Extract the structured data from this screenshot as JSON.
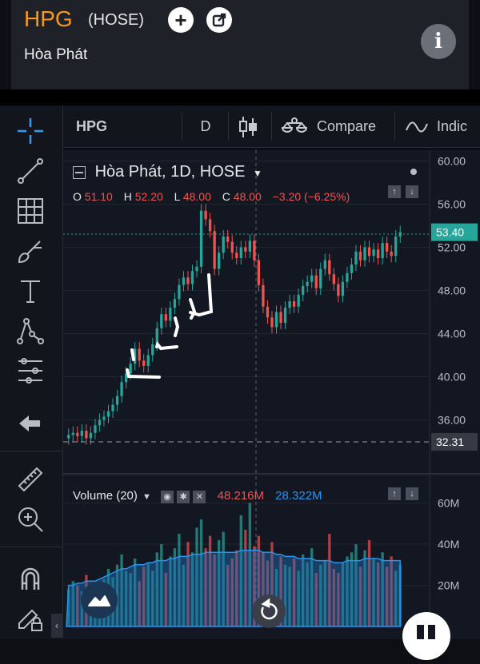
{
  "header": {
    "symbol": "HPG",
    "exchange": "(HOSE)",
    "company_name": "Hòa Phát",
    "add_icon": "plus-circle-icon",
    "share_icon": "external-link-icon",
    "info_icon": "info-icon"
  },
  "toolbar": {
    "symbol": "HPG",
    "interval": "D",
    "chart_type_icon": "candlestick-icon",
    "compare_label": "Compare",
    "indicators_label": "Indic"
  },
  "sidebar": {
    "tools": [
      "crosshair-icon",
      "trendline-icon",
      "fib-grid-icon",
      "brush-icon",
      "text-icon",
      "pattern-icon",
      "prediction-icon",
      "back-arrow-icon",
      "ruler-icon",
      "zoom-in-icon",
      "magnet-icon",
      "lock-draw-icon"
    ]
  },
  "legend": {
    "title": "Hòa Phát, 1D, HOSE",
    "o_label": "O",
    "o_value": "51.10",
    "h_label": "H",
    "h_value": "52.20",
    "l_label": "L",
    "l_value": "48.00",
    "c_label": "C",
    "c_value": "48.00",
    "change": "−3.20 (−6.25%)"
  },
  "volume_legend": {
    "label": "Volume (20)",
    "value1": "48.216M",
    "value2": "28.322M"
  },
  "colors": {
    "up": "#26a69a",
    "down": "#ef5350",
    "accent": "#f39a1e",
    "ma": "#2196f3"
  },
  "chart_data": {
    "type": "candlestick",
    "price_axis_labels": [
      "60.00",
      "56.00",
      "52.00",
      "48.00",
      "44.00",
      "40.00",
      "36.00"
    ],
    "ylim": [
      31,
      61
    ],
    "last_price": "53.40",
    "dashed_level": "32.31",
    "volume_axis_labels": [
      "60M",
      "40M",
      "20M"
    ],
    "volume_ylim": [
      0,
      66
    ],
    "closes": [
      34.6,
      34.8,
      34.5,
      35.0,
      34.3,
      34.8,
      35.5,
      36.0,
      36.3,
      36.8,
      37.4,
      38.2,
      39.5,
      40.3,
      41.2,
      42.6,
      41.5,
      41.0,
      42.0,
      43.0,
      44.5,
      45.8,
      45.2,
      46.4,
      47.2,
      48.5,
      49.2,
      48.6,
      49.8,
      50.2,
      55.4,
      54.6,
      53.5,
      50.0,
      51.5,
      53.0,
      52.5,
      51.5,
      51.0,
      52.0,
      51.6,
      52.6,
      50.8,
      48.5,
      46.5,
      45.5,
      44.6,
      46.0,
      45.0,
      46.4,
      47.0,
      46.5,
      47.6,
      48.4,
      48.8,
      49.4,
      48.2,
      50.0,
      50.8,
      49.5,
      48.6,
      47.5,
      48.8,
      49.6,
      50.4,
      51.6,
      50.8,
      52.0,
      51.2,
      51.8,
      51.0,
      52.4,
      51.6,
      51.2,
      53.0,
      53.4
    ],
    "volumes": [
      18,
      22,
      20,
      17,
      25,
      19,
      21,
      16,
      23,
      28,
      24,
      30,
      35,
      27,
      26,
      33,
      22,
      29,
      31,
      27,
      36,
      40,
      26,
      34,
      38,
      45,
      30,
      41,
      36,
      48,
      52,
      38,
      44,
      35,
      42,
      46,
      30,
      33,
      37,
      54,
      47,
      60,
      39,
      44,
      36,
      32,
      41,
      28,
      34,
      30,
      29,
      33,
      27,
      35,
      31,
      38,
      26,
      30,
      32,
      45,
      28,
      26,
      31,
      34,
      36,
      40,
      29,
      37,
      42,
      33,
      31,
      36,
      29,
      34,
      27,
      30
    ],
    "volume_ma": [
      20,
      20,
      21,
      21,
      22,
      22,
      22,
      23,
      24,
      25,
      26,
      27,
      28,
      28,
      29,
      30,
      30,
      30,
      31,
      31,
      32,
      32,
      32,
      33,
      33,
      34,
      34,
      34,
      35,
      35,
      35,
      36,
      36,
      36,
      36,
      36,
      36,
      36,
      36,
      37,
      37,
      37,
      37,
      37,
      36,
      36,
      36,
      35,
      35,
      34,
      34,
      34,
      33,
      33,
      33,
      33,
      32,
      32,
      32,
      32,
      31,
      31,
      31,
      32,
      32,
      32,
      32,
      33,
      33,
      33,
      33,
      32,
      32,
      32,
      32,
      32
    ]
  }
}
